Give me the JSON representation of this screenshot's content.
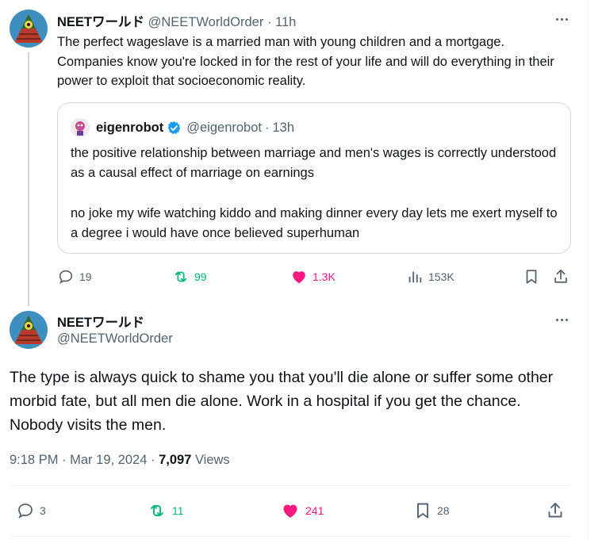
{
  "tweet1": {
    "display_name": "NEETワールド",
    "handle": "@NEETWorldOrder",
    "separator": "·",
    "time": "11h",
    "text": "The perfect wageslave is a married man with young children and a mortgage. Companies know you're locked in for the rest of your life and will do everything in their power to exploit that socioeconomic reality.",
    "quote": {
      "display_name": "eigenrobot",
      "handle": "@eigenrobot",
      "separator": "·",
      "time": "13h",
      "paragraph1": "the positive relationship between marriage and men's wages is correctly understood as a causal effect of marriage on earnings",
      "paragraph2": "no joke my wife watching kiddo and making dinner every day lets me exert myself to a degree i would have once believed superhuman"
    },
    "actions": {
      "replies": "19",
      "reposts": "99",
      "likes": "1.3K",
      "views": "153K"
    }
  },
  "tweet2": {
    "display_name": "NEETワールド",
    "handle": "@NEETWorldOrder",
    "text": "The type is always quick to shame you that you'll die alone or suffer some other morbid fate, but all men die alone. Work in a hospital if you get the chance. Nobody visits the men.",
    "time": "9:18 PM",
    "separator": "·",
    "date": "Mar 19, 2024",
    "views_count": "7,097",
    "views_label": "Views",
    "actions": {
      "replies": "3",
      "reposts": "11",
      "likes": "241",
      "bookmarks": "28"
    }
  },
  "colors": {
    "text": "#0f1419",
    "secondary": "#536471",
    "repost_green": "#00ba7c",
    "like_pink": "#f91880",
    "verified_blue": "#1d9bf0",
    "border": "#cfd9de"
  },
  "icons": [
    "reply-icon",
    "repost-icon",
    "like-icon",
    "views-icon",
    "bookmark-icon",
    "share-icon",
    "more-icon",
    "verified-badge-icon"
  ]
}
